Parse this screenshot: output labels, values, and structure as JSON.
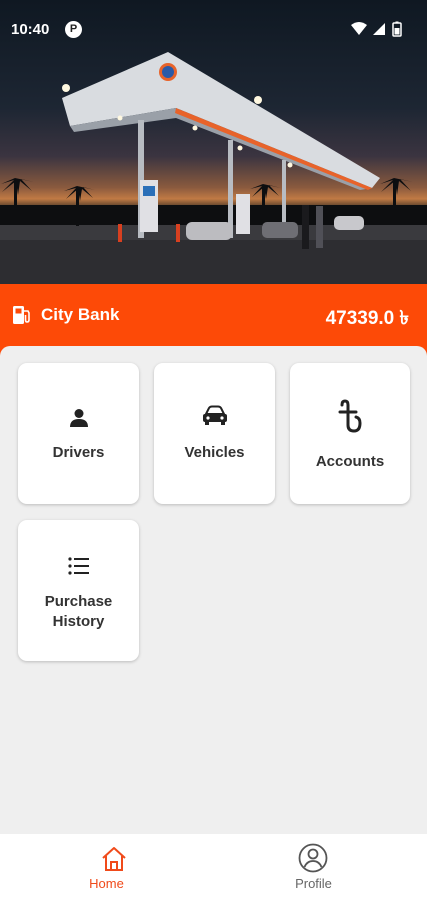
{
  "status_bar": {
    "time": "10:40",
    "app_badge": "P",
    "icons": [
      "wifi-icon",
      "signal-icon",
      "battery-icon"
    ]
  },
  "hero": {
    "image": "gas-station-night-photo"
  },
  "header": {
    "company": "City Bank",
    "balance": "47339.0 ৳",
    "icon": "fuel-pump-icon"
  },
  "menu": [
    {
      "label": "Drivers",
      "icon": "person-icon"
    },
    {
      "label": "Vehicles",
      "icon": "car-icon"
    },
    {
      "label": "Accounts",
      "icon": "taka-icon"
    },
    {
      "label": "Purchase\nHistory",
      "icon": "list-icon"
    }
  ],
  "bottom_nav": {
    "items": [
      {
        "label": "Home",
        "icon": "home-icon",
        "active": true
      },
      {
        "label": "Profile",
        "icon": "profile-icon",
        "active": false
      }
    ]
  },
  "colors": {
    "accent": "#fd4a07",
    "active_nav": "#f04a1a",
    "inactive_nav": "#666666"
  }
}
